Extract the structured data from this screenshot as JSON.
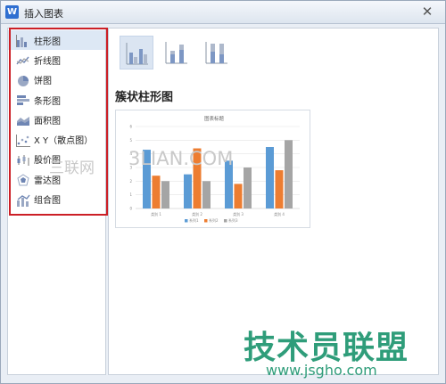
{
  "window": {
    "title": "插入图表",
    "app_icon": "W",
    "close_glyph": "✕"
  },
  "sidebar": {
    "items": [
      {
        "label": "柱形图",
        "icon": "column-chart-icon",
        "selected": true
      },
      {
        "label": "折线图",
        "icon": "line-chart-icon"
      },
      {
        "label": "饼图",
        "icon": "pie-chart-icon"
      },
      {
        "label": "条形图",
        "icon": "bar-chart-icon"
      },
      {
        "label": "面积图",
        "icon": "area-chart-icon"
      },
      {
        "label": "X Y（散点图）",
        "icon": "scatter-chart-icon"
      },
      {
        "label": "股价图",
        "icon": "stock-chart-icon"
      },
      {
        "label": "雷达图",
        "icon": "radar-chart-icon"
      },
      {
        "label": "组合图",
        "icon": "combo-chart-icon"
      }
    ]
  },
  "main": {
    "subtypes": [
      {
        "name": "clustered-column",
        "selected": true
      },
      {
        "name": "stacked-column"
      },
      {
        "name": "percent-stacked-column"
      }
    ],
    "preview_heading": "簇状柱形图"
  },
  "chart_data": {
    "type": "bar",
    "title": "图表标题",
    "categories": [
      "类别 1",
      "类别 2",
      "类别 3",
      "类别 4"
    ],
    "series": [
      {
        "name": "系列1",
        "values": [
          4.3,
          2.5,
          3.5,
          4.5
        ]
      },
      {
        "name": "系列2",
        "values": [
          2.4,
          4.4,
          1.8,
          2.8
        ]
      },
      {
        "name": "系列3",
        "values": [
          2.0,
          2.0,
          3.0,
          5.0
        ]
      }
    ],
    "ylim": [
      0,
      6
    ],
    "colors": [
      "#5b9bd5",
      "#ed7d31",
      "#a5a5a5"
    ],
    "grid": true,
    "legend": "bottom"
  },
  "watermarks": {
    "site_cn": "三联网",
    "site_url": "3LIAN.COM",
    "brand": "技术员联盟",
    "brand_url": "www.jsgho.com"
  }
}
